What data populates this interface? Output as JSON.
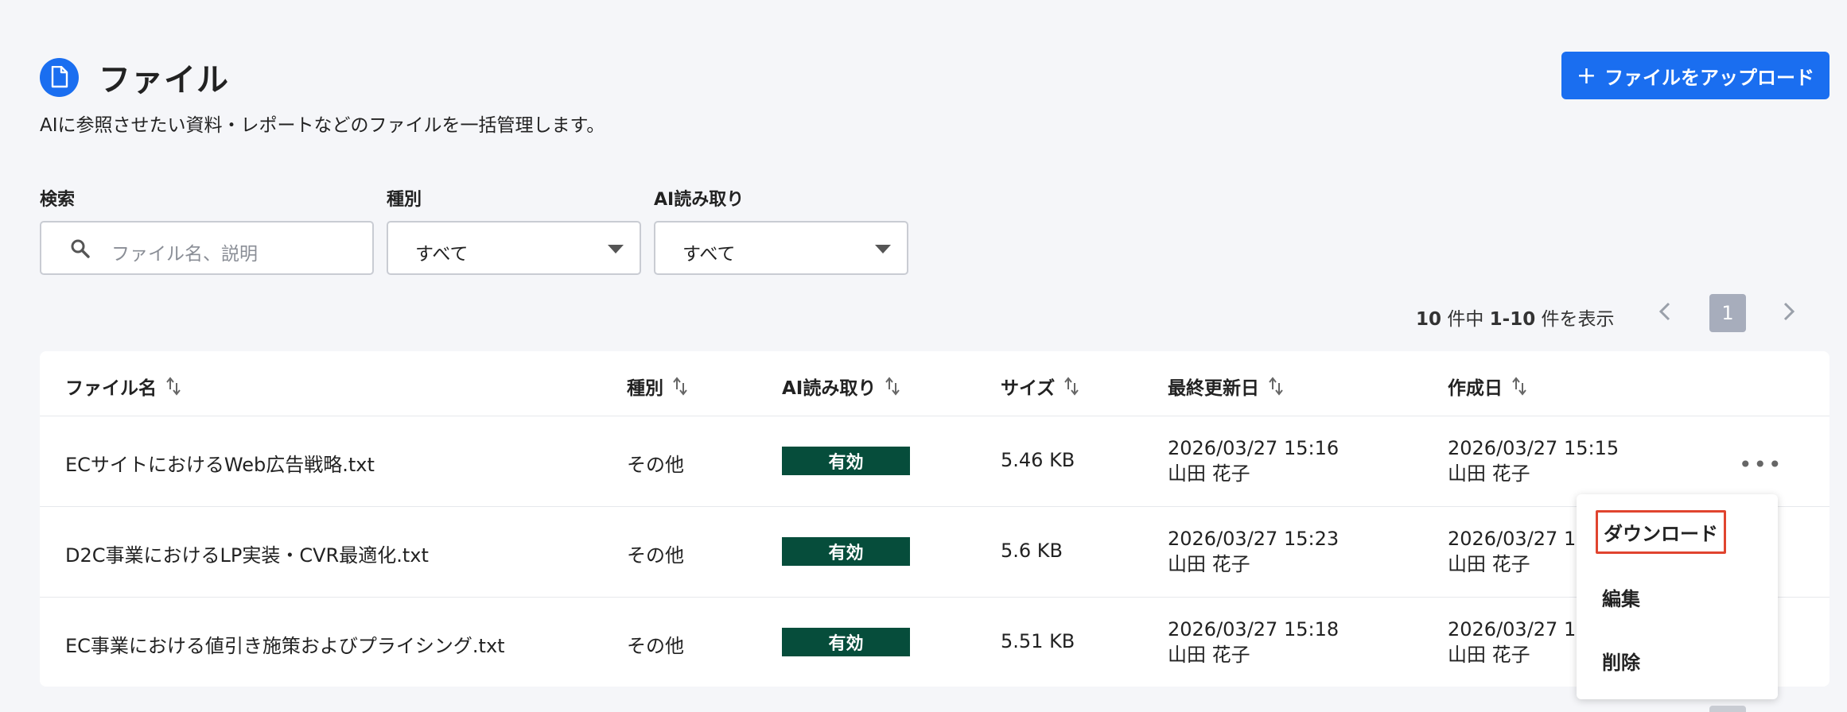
{
  "page": {
    "title": "ファイル",
    "subtitle": "AIに参照させたい資料・レポートなどのファイルを一括管理します。",
    "icon": "document-icon",
    "upload_label": "ファイルをアップロード",
    "accent_color": "#1a6ef0"
  },
  "filters": {
    "search_label": "検索",
    "search_placeholder": "ファイル名、説明",
    "type_label": "種別",
    "type_value": "すべて",
    "ai_label": "AI読み取り",
    "ai_value": "すべて"
  },
  "pagination": {
    "total": "10",
    "total_suffix": " 件中 ",
    "range": "1-10",
    "range_suffix": " 件を表示",
    "current_page": "1"
  },
  "table": {
    "columns": [
      "ファイル名",
      "種別",
      "AI読み取り",
      "サイズ",
      "最終更新日",
      "作成日"
    ],
    "rows": [
      {
        "name": "ECサイトにおけるWeb広告戦略.txt",
        "type": "その他",
        "ai": "有効",
        "size": "5.46 KB",
        "updated_date": "2026/03/27 15:16",
        "updated_by": "山田 花子",
        "created_date": "2026/03/27 15:15",
        "created_by": "山田 花子"
      },
      {
        "name": "D2C事業におけるLP実装・CVR最適化.txt",
        "type": "その他",
        "ai": "有効",
        "size": "5.6 KB",
        "updated_date": "2026/03/27 15:23",
        "updated_by": "山田 花子",
        "created_date": "2026/03/27 15:",
        "created_by": "山田 花子"
      },
      {
        "name": "EC事業における値引き施策およびプライシング.txt",
        "type": "その他",
        "ai": "有効",
        "size": "5.51 KB",
        "updated_date": "2026/03/27 15:18",
        "updated_by": "山田 花子",
        "created_date": "2026/03/27 15:",
        "created_by": "山田 花子"
      }
    ],
    "badge_color": "#064d3b"
  },
  "row_menu": {
    "items": [
      "ダウンロード",
      "編集",
      "削除"
    ],
    "highlight_color": "#e0442f"
  }
}
